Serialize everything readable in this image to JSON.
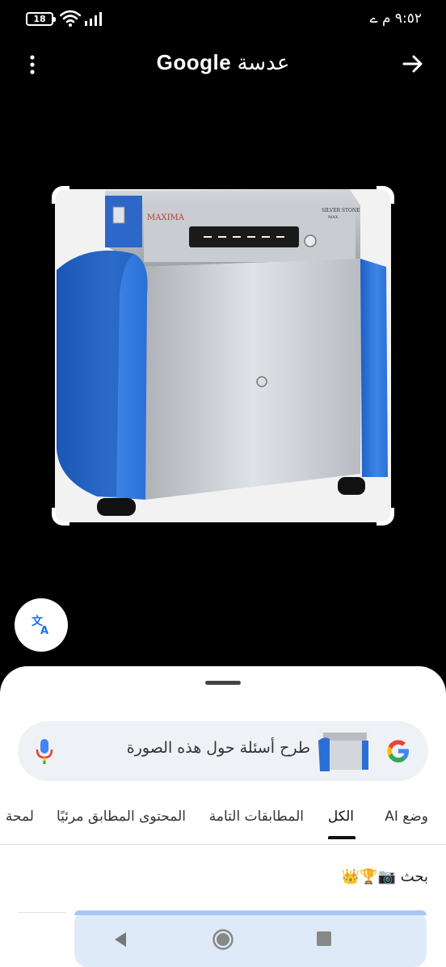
{
  "status_bar": {
    "battery_level": "18",
    "time": "٩:٥٢ م",
    "indicator": "ے"
  },
  "app_bar": {
    "title_google": "Google",
    "title_lens": "عدسة"
  },
  "search": {
    "placeholder": "طرح أسئلة حول هذه الصورة"
  },
  "tabs": [
    {
      "label": "وضع AI"
    },
    {
      "label": "الكل",
      "active": true
    },
    {
      "label": "المطابقات التامة"
    },
    {
      "label": "المحتوى المطابق مرئيًا"
    },
    {
      "label": "لمحة عن"
    }
  ],
  "section": {
    "title": "بحث",
    "emoji": "👑🏆📷"
  },
  "product": {
    "brand_label": "MAXIMA",
    "model_label": "SILVER STONE",
    "model_sub": "MAX"
  },
  "colors": {
    "accent_blue": "#1a73e8",
    "device_blue": "#2a6fd6",
    "device_silver": "#c9ccd1",
    "background": "#000000"
  }
}
